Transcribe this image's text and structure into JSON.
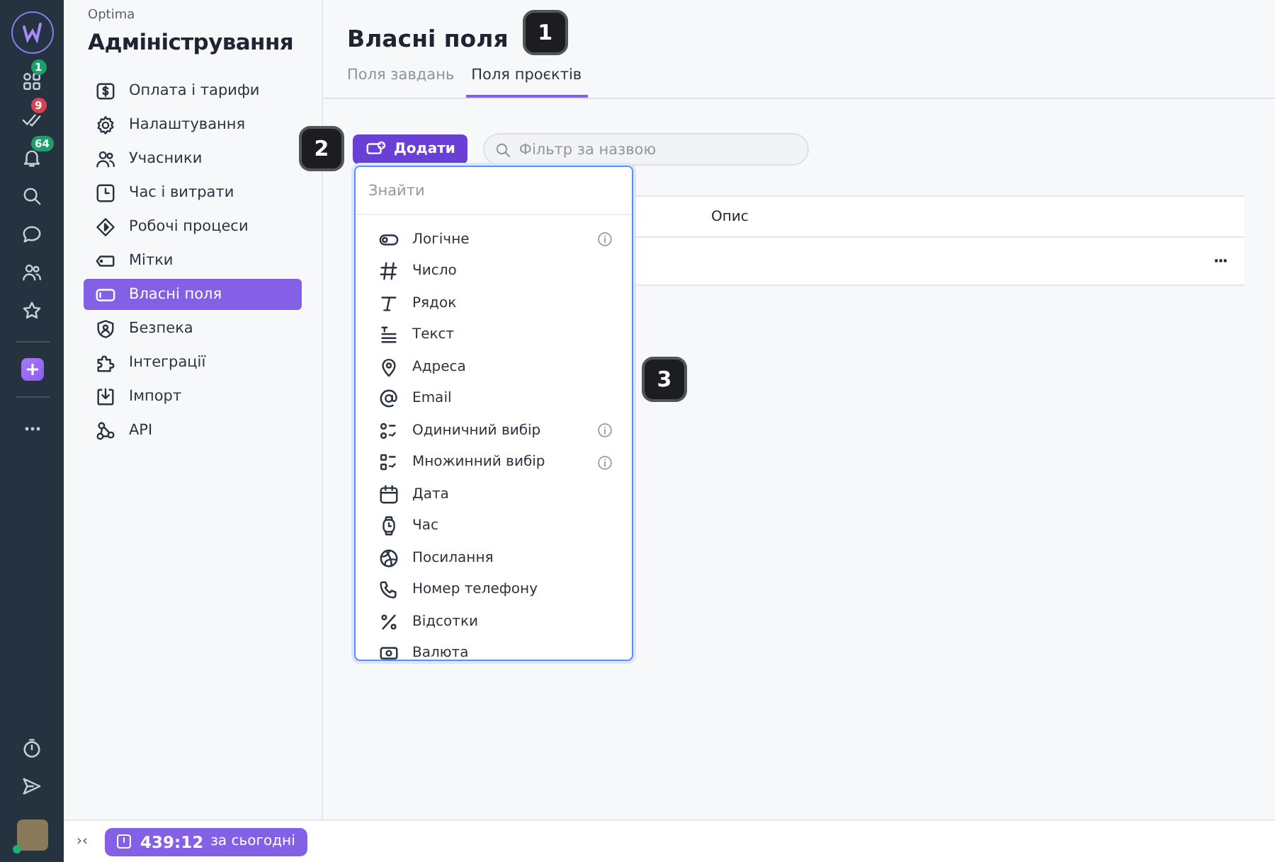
{
  "rail": {
    "badges": [
      {
        "text": "1",
        "color": "#1f9d6b"
      },
      {
        "text": "9",
        "color": "#d9434f"
      },
      {
        "text": "64",
        "color": "#1f9d6b"
      }
    ]
  },
  "sidebar": {
    "org": "Optima",
    "title": "Адміністрування",
    "items": [
      {
        "label": "Оплата і тарифи",
        "selected": false
      },
      {
        "label": "Налаштування",
        "selected": false
      },
      {
        "label": "Учасники",
        "selected": false
      },
      {
        "label": "Час і витрати",
        "selected": false
      },
      {
        "label": "Робочі процеси",
        "selected": false
      },
      {
        "label": "Мітки",
        "selected": false
      },
      {
        "label": "Власні поля",
        "selected": true
      },
      {
        "label": "Безпека",
        "selected": false
      },
      {
        "label": "Інтеграції",
        "selected": false
      },
      {
        "label": "Імпорт",
        "selected": false
      },
      {
        "label": "API",
        "selected": false
      }
    ]
  },
  "page": {
    "title": "Власні поля",
    "tabs": [
      {
        "label": "Поля завдань",
        "selected": false
      },
      {
        "label": "Поля проєктів",
        "selected": true
      }
    ]
  },
  "toolbar": {
    "add_button": "Додати",
    "filter": {
      "placeholder": "Фільтр за назвою"
    }
  },
  "table": {
    "columns": [
      "Опис"
    ],
    "row_menu": "···"
  },
  "dropdown": {
    "search": {
      "placeholder": "Знайти"
    },
    "items": [
      {
        "label": "Логічне",
        "info": true
      },
      {
        "label": "Число",
        "info": false
      },
      {
        "label": "Рядок",
        "info": false
      },
      {
        "label": "Текст",
        "info": false
      },
      {
        "label": "Адреса",
        "info": false
      },
      {
        "label": "Email",
        "info": false
      },
      {
        "label": "Одиничний вибір",
        "info": true
      },
      {
        "label": "Множинний вибір",
        "info": true
      },
      {
        "label": "Дата",
        "info": false
      },
      {
        "label": "Час",
        "info": false
      },
      {
        "label": "Посилання",
        "info": false
      },
      {
        "label": "Номер телефону",
        "info": false
      },
      {
        "label": "Відсотки",
        "info": false
      },
      {
        "label": "Валюта",
        "info": false
      }
    ]
  },
  "callouts": [
    "1",
    "2",
    "3"
  ],
  "status_bar": {
    "collapse": "›‹",
    "timer": "439:12",
    "timer_note": "за сьогодні"
  }
}
